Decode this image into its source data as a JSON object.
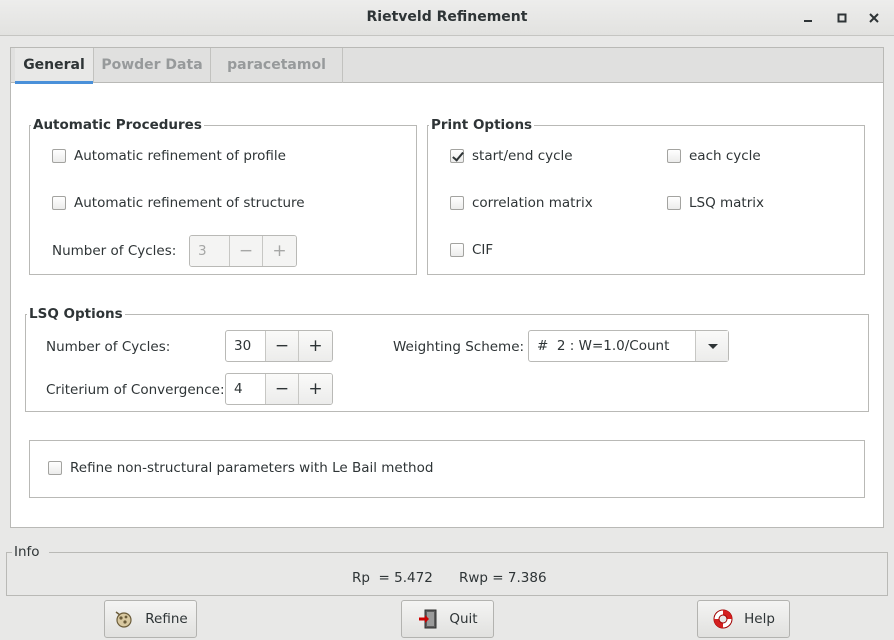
{
  "window": {
    "title": "Rietveld Refinement"
  },
  "tabs": [
    {
      "label": "General",
      "active": true
    },
    {
      "label": "Powder Data",
      "active": false
    },
    {
      "label": "paracetamol",
      "active": false
    }
  ],
  "automatic_procedures": {
    "title": "Automatic Procedures",
    "refine_profile": {
      "label": "Automatic refinement of profile",
      "checked": false
    },
    "refine_structure": {
      "label": "Automatic refinement of structure",
      "checked": false
    },
    "cycles": {
      "label": "Number of Cycles:",
      "value": "3",
      "enabled": false,
      "minus": "−",
      "plus": "+"
    }
  },
  "print_options": {
    "title": "Print Options",
    "start_end_cycle": {
      "label": "start/end cycle",
      "checked": true
    },
    "each_cycle": {
      "label": "each cycle",
      "checked": false
    },
    "correlation_matrix": {
      "label": "correlation matrix",
      "checked": false
    },
    "lsq_matrix": {
      "label": "LSQ matrix",
      "checked": false
    },
    "cif": {
      "label": "CIF",
      "checked": false
    }
  },
  "lsq_options": {
    "title": "LSQ Options",
    "cycles": {
      "label": "Number of Cycles:",
      "value": "30",
      "minus": "−",
      "plus": "+"
    },
    "convergence": {
      "label": "Criterium of Convergence:",
      "value": "4",
      "minus": "−",
      "plus": "+"
    },
    "weighting": {
      "label": "Weighting Scheme:",
      "value": "#  2 : W=1.0/Count"
    }
  },
  "le_bail": {
    "label": "Refine non-structural parameters with Le Bail method",
    "checked": false
  },
  "info": {
    "title": "Info",
    "rp": "Rp  = 5.472",
    "rwp": "Rwp = 7.386"
  },
  "buttons": {
    "refine": "Refine",
    "quit": "Quit",
    "help": "Help"
  },
  "colors": {
    "accent": "#4a90d9",
    "background": "#e8e8e7",
    "panel": "#ffffff"
  }
}
